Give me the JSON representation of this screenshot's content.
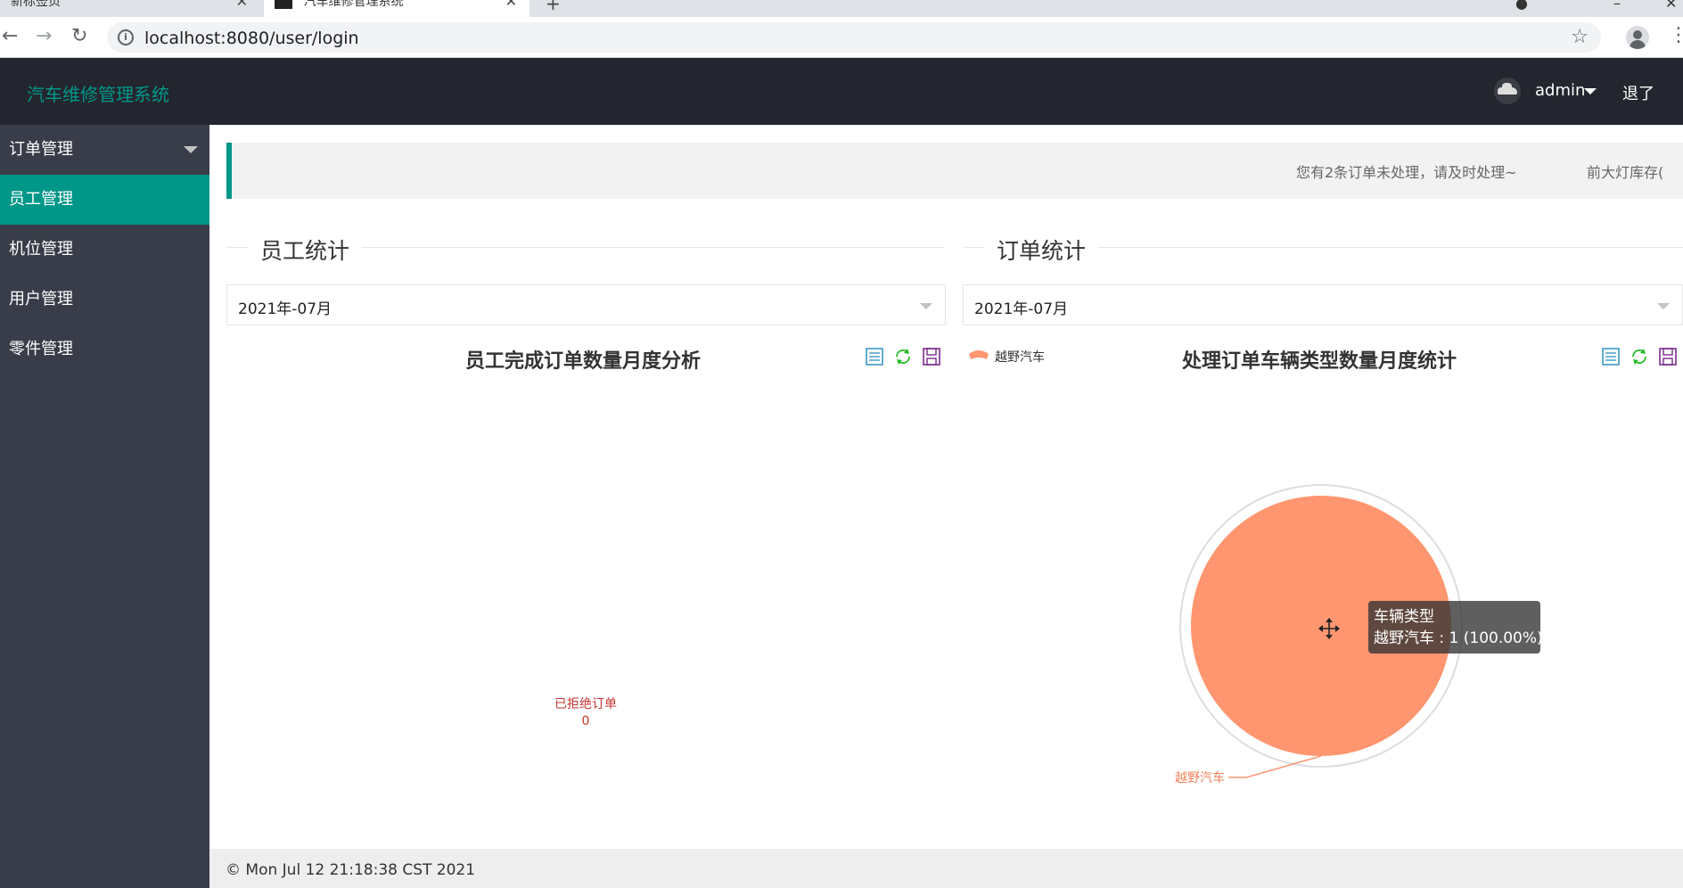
{
  "browser": {
    "tabs": [
      {
        "title": "新标签页"
      },
      {
        "title": "汽车维修管理系统"
      }
    ],
    "new_tab": "+",
    "url": "localhost:8080/user/login"
  },
  "app": {
    "logo": "汽车维修管理系统",
    "user_name": "admin",
    "logout": "退了"
  },
  "sidebar": {
    "items": [
      {
        "label": "订单管理"
      },
      {
        "label": "员工管理"
      },
      {
        "label": "机位管理"
      },
      {
        "label": "用户管理"
      },
      {
        "label": "零件管理"
      }
    ]
  },
  "notice": {
    "text": "您有2条订单未处理，请及时处理~",
    "scroll_text": "前大灯库存(",
    "accent": "#009688"
  },
  "employee_section": {
    "legend": "员工统计",
    "month": "2021年-07月"
  },
  "order_section": {
    "legend": "订单统计",
    "month": "2021年-07月"
  },
  "chart_data": [
    {
      "type": "pie",
      "title": "员工完成订单数量月度分析",
      "categories": [
        "已拒绝订单"
      ],
      "values": [
        0
      ]
    },
    {
      "type": "pie",
      "title": "处理订单车辆类型数量月度统计",
      "categories": [
        "越野汽车"
      ],
      "values": [
        1
      ],
      "legend": "top-left",
      "series_name": "车辆类型",
      "color": "#ff9670",
      "tooltip": {
        "title": "车辆类型",
        "line": "越野汽车 : 1 (100.00%)"
      }
    }
  ],
  "footer": {
    "text": "© Mon Jul 12 21:18:38 CST 2021"
  },
  "icons": {
    "data_view": "data-view-icon",
    "restore": "restore-icon",
    "save_image": "save-image-icon"
  }
}
